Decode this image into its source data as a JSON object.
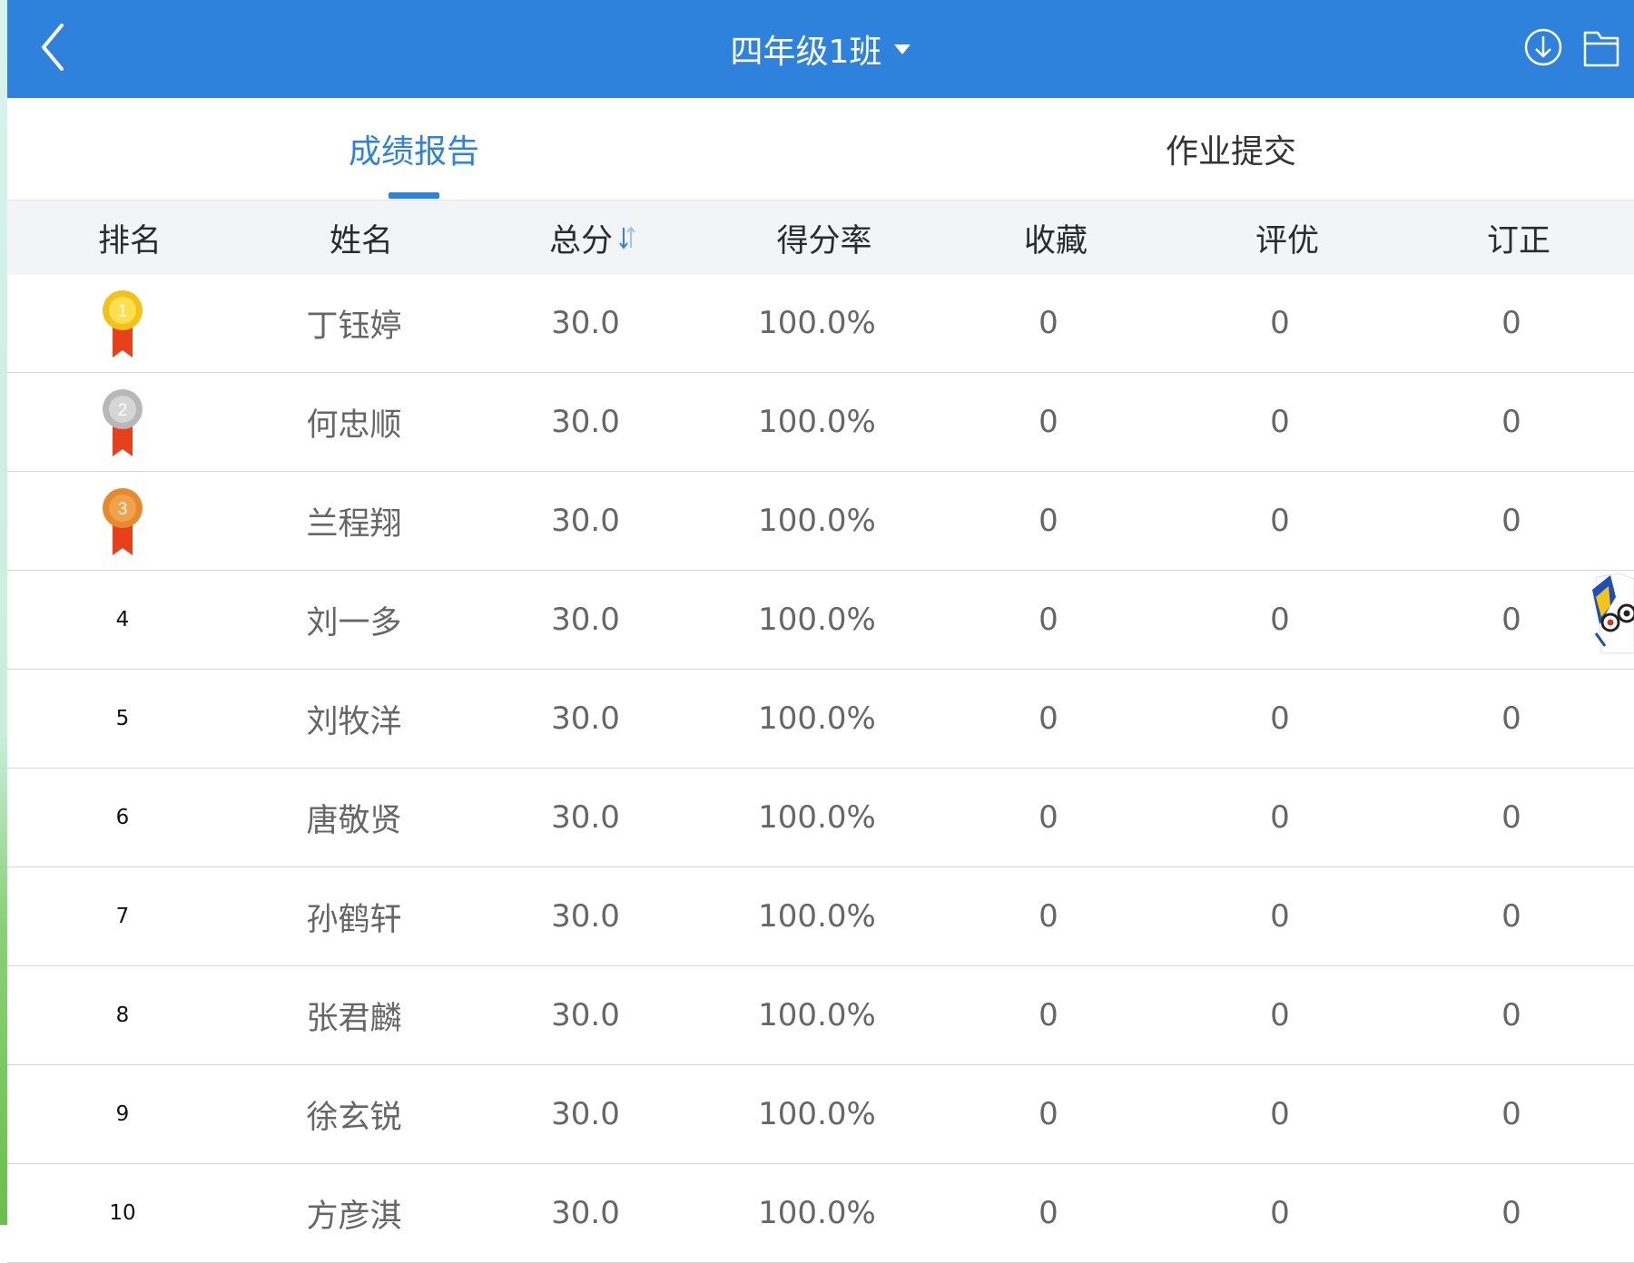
{
  "header": {
    "title": "四年级1班",
    "back_icon": "chevron-left-icon",
    "download_icon": "download-icon",
    "folder_icon": "folder-icon",
    "color": "#2f82dc"
  },
  "tabs": [
    {
      "label": "成绩报告",
      "active": true
    },
    {
      "label": "作业提交",
      "active": false
    }
  ],
  "table": {
    "columns": [
      "排名",
      "姓名",
      "总分",
      "得分率",
      "收藏",
      "评优",
      "订正"
    ],
    "sort_column": "总分",
    "rows": [
      {
        "rank": "1",
        "name": "丁钰婷",
        "score": "30.0",
        "rate": "100.0%",
        "fav": "0",
        "excellent": "0",
        "correction": "0"
      },
      {
        "rank": "2",
        "name": "何忠顺",
        "score": "30.0",
        "rate": "100.0%",
        "fav": "0",
        "excellent": "0",
        "correction": "0"
      },
      {
        "rank": "3",
        "name": "兰程翔",
        "score": "30.0",
        "rate": "100.0%",
        "fav": "0",
        "excellent": "0",
        "correction": "0"
      },
      {
        "rank": "4",
        "name": "刘一多",
        "score": "30.0",
        "rate": "100.0%",
        "fav": "0",
        "excellent": "0",
        "correction": "0"
      },
      {
        "rank": "5",
        "name": "刘牧洋",
        "score": "30.0",
        "rate": "100.0%",
        "fav": "0",
        "excellent": "0",
        "correction": "0"
      },
      {
        "rank": "6",
        "name": "唐敬贤",
        "score": "30.0",
        "rate": "100.0%",
        "fav": "0",
        "excellent": "0",
        "correction": "0"
      },
      {
        "rank": "7",
        "name": "孙鹤轩",
        "score": "30.0",
        "rate": "100.0%",
        "fav": "0",
        "excellent": "0",
        "correction": "0"
      },
      {
        "rank": "8",
        "name": "张君麟",
        "score": "30.0",
        "rate": "100.0%",
        "fav": "0",
        "excellent": "0",
        "correction": "0"
      },
      {
        "rank": "9",
        "name": "徐玄锐",
        "score": "30.0",
        "rate": "100.0%",
        "fav": "0",
        "excellent": "0",
        "correction": "0"
      },
      {
        "rank": "10",
        "name": "方彦淇",
        "score": "30.0",
        "rate": "100.0%",
        "fav": "0",
        "excellent": "0",
        "correction": "0"
      }
    ]
  },
  "medal_colors": {
    "gold": "#f2c21a",
    "silver": "#b8b8b8",
    "bronze": "#e68a2e",
    "ribbon": "#e8401c"
  }
}
